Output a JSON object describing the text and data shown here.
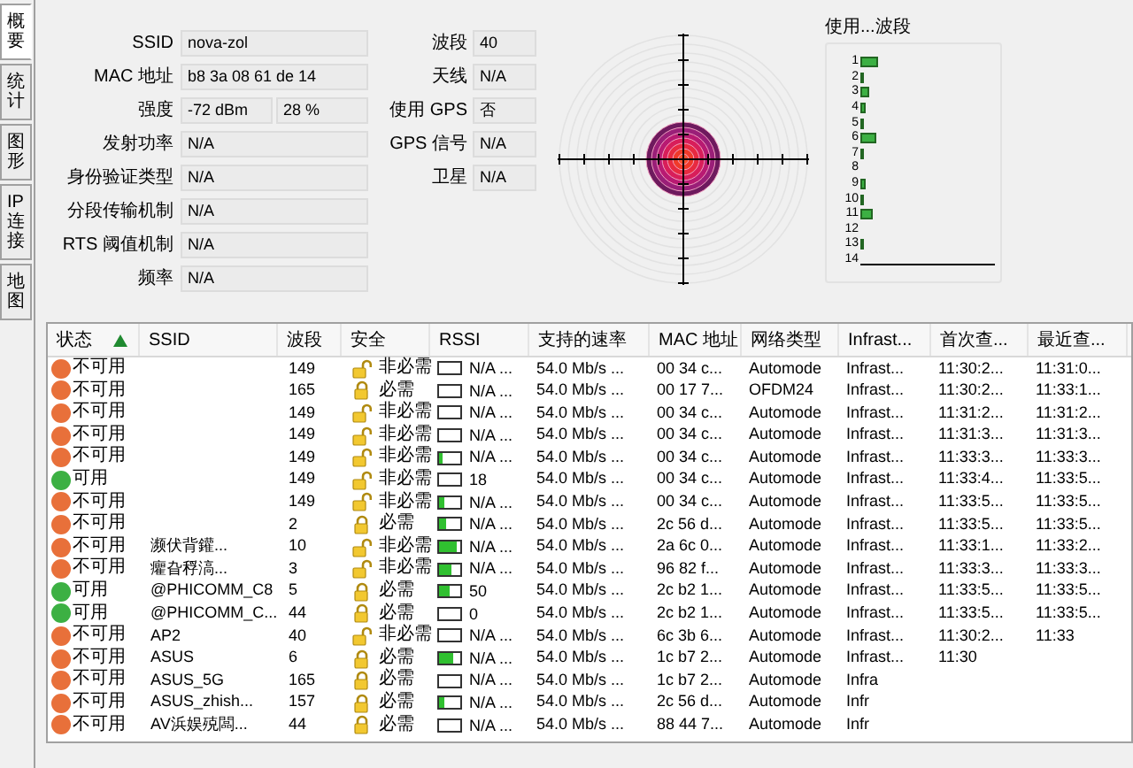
{
  "side_tabs": [
    {
      "label": "概要",
      "selected": true
    },
    {
      "label": "统计",
      "selected": false
    },
    {
      "label": "图形",
      "selected": false
    },
    {
      "label": "IP连接",
      "selected": false
    },
    {
      "label": "地图",
      "selected": false
    }
  ],
  "details": {
    "left": [
      {
        "label": "SSID",
        "value": "nova-zol"
      },
      {
        "label": "MAC 地址",
        "value": "b8 3a 08 61 de 14"
      },
      {
        "label": "强度",
        "value": "-72 dBm",
        "value_2": "28 %"
      },
      {
        "label": "发射功率",
        "value": "N/A"
      },
      {
        "label": "身份验证类型",
        "value": "N/A"
      },
      {
        "label": "分段传输机制",
        "value": "N/A"
      },
      {
        "label": "RTS 阈值机制",
        "value": "N/A"
      },
      {
        "label": "频率",
        "value": "N/A"
      }
    ],
    "right": [
      {
        "label": "波段",
        "value": "40"
      },
      {
        "label": "天线",
        "value": "N/A"
      },
      {
        "label": "使用 GPS",
        "value": "否"
      },
      {
        "label": "GPS 信号",
        "value": "N/A"
      },
      {
        "label": "卫星",
        "value": "N/A"
      }
    ]
  },
  "band_usage": {
    "title": "使用...波段",
    "channels": [
      "1",
      "2",
      "3",
      "4",
      "5",
      "6",
      "7",
      "8",
      "9",
      "10",
      "11",
      "12",
      "13",
      "14"
    ]
  },
  "table": {
    "columns": [
      {
        "label": "状态",
        "sorted": true
      },
      {
        "label": "SSID",
        "sorted": false
      },
      {
        "label": "波段",
        "sorted": false
      },
      {
        "label": "安全",
        "sorted": false
      },
      {
        "label": "RSSI",
        "sorted": false
      },
      {
        "label": "支持的速率",
        "sorted": false
      },
      {
        "label": "MAC 地址",
        "sorted": false
      },
      {
        "label": "网络类型",
        "sorted": false
      },
      {
        "label": "Infrast...",
        "sorted": false
      },
      {
        "label": "首次查...",
        "sorted": false
      },
      {
        "label": "最近查...",
        "sorted": false
      }
    ],
    "rows": [
      {
        "status": "不可用",
        "color": "#e8703a",
        "band": "149",
        "locked": false,
        "security": "非必需",
        "level": 0,
        "rssi": "N/A ...",
        "rate": "54.0 Mb/s ...",
        "mac": "00 34 c...",
        "net_type": "Automode",
        "infra": "Infrast...",
        "first_seen": "11:30:2...",
        "last_seen": "11:31:0..."
      },
      {
        "status": "不可用",
        "color": "#e8703a",
        "band": "165",
        "locked": true,
        "security": "必需",
        "level": 0,
        "rssi": "N/A ...",
        "rate": "54.0 Mb/s ...",
        "mac": "00 17 7...",
        "net_type": "OFDM24",
        "infra": "Infrast...",
        "first_seen": "11:30:2...",
        "last_seen": "11:33:1..."
      },
      {
        "status": "不可用",
        "color": "#e8703a",
        "band": "149",
        "locked": false,
        "security": "非必需",
        "level": 0,
        "rssi": "N/A ...",
        "rate": "54.0 Mb/s ...",
        "mac": "00 34 c...",
        "net_type": "Automode",
        "infra": "Infrast...",
        "first_seen": "11:31:2...",
        "last_seen": "11:31:2..."
      },
      {
        "status": "不可用",
        "color": "#e8703a",
        "band": "149",
        "locked": false,
        "security": "非必需",
        "level": 0,
        "rssi": "N/A ...",
        "rate": "54.0 Mb/s ...",
        "mac": "00 34 c...",
        "net_type": "Automode",
        "infra": "Infrast...",
        "first_seen": "11:31:3...",
        "last_seen": "11:31:3..."
      },
      {
        "status": "不可用",
        "color": "#e8703a",
        "band": "149",
        "locked": false,
        "security": "非必需",
        "level": 0.2,
        "rssi": "N/A ...",
        "rate": "54.0 Mb/s ...",
        "mac": "00 34 c...",
        "net_type": "Automode",
        "infra": "Infrast...",
        "first_seen": "11:33:3...",
        "last_seen": "11:33:3..."
      },
      {
        "status": "可用",
        "color": "#3cb043",
        "band": "149",
        "locked": false,
        "security": "非必需",
        "level": 0,
        "rssi": "18",
        "rate": "54.0 Mb/s ...",
        "mac": "00 34 c...",
        "net_type": "Automode",
        "infra": "Infrast...",
        "first_seen": "11:33:4...",
        "last_seen": "11:33:5..."
      },
      {
        "status": "不可用",
        "color": "#e8703a",
        "band": "149",
        "locked": false,
        "security": "非必需",
        "level": 0.25,
        "rssi": "N/A ...",
        "rate": "54.0 Mb/s ...",
        "mac": "00 34 c...",
        "net_type": "Automode",
        "infra": "Infrast...",
        "first_seen": "11:33:5...",
        "last_seen": "11:33:5..."
      },
      {
        "status": "不可用",
        "color": "#e8703a",
        "band": "2",
        "locked": true,
        "security": "必需",
        "level": 0.3,
        "rssi": "N/A ...",
        "rate": "54.0 Mb/s ...",
        "mac": "2c 56 d...",
        "net_type": "Automode",
        "infra": "Infrast...",
        "first_seen": "11:33:5...",
        "last_seen": "11:33:5..."
      },
      {
        "status": "不可用",
        "color": "#e8703a",
        "ssid": "濒伏背鑵...",
        "band": "10",
        "locked": false,
        "security": "非必需",
        "level": 0.8,
        "rssi": "N/A ...",
        "rate": "54.0 Mb/s ...",
        "mac": "2a 6c 0...",
        "net_type": "Automode",
        "infra": "Infrast...",
        "first_seen": "11:33:1...",
        "last_seen": "11:33:2..."
      },
      {
        "status": "不可用",
        "color": "#e8703a",
        "ssid": "癯旮稃滈...",
        "band": "3",
        "locked": false,
        "security": "非必需",
        "level": 0.6,
        "rssi": "N/A ...",
        "rate": "54.0 Mb/s ...",
        "mac": "96 82 f...",
        "net_type": "Automode",
        "infra": "Infrast...",
        "first_seen": "11:33:3...",
        "last_seen": "11:33:3..."
      },
      {
        "status": "可用",
        "color": "#3cb043",
        "ssid": "@PHICOMM_C8",
        "band": "5",
        "locked": true,
        "security": "必需",
        "level": 0.5,
        "rssi": "50",
        "rate": "54.0 Mb/s ...",
        "mac": "2c b2 1...",
        "net_type": "Automode",
        "infra": "Infrast...",
        "first_seen": "11:33:5...",
        "last_seen": "11:33:5..."
      },
      {
        "status": "可用",
        "color": "#3cb043",
        "ssid": "@PHICOMM_C...",
        "band": "44",
        "locked": true,
        "security": "必需",
        "level": 0,
        "rssi": "0",
        "rate": "54.0 Mb/s ...",
        "mac": "2c b2 1...",
        "net_type": "Automode",
        "infra": "Infrast...",
        "first_seen": "11:33:5...",
        "last_seen": "11:33:5..."
      },
      {
        "status": "不可用",
        "color": "#e8703a",
        "ssid": "AP2",
        "band": "40",
        "locked": false,
        "security": "非必需",
        "level": 0,
        "rssi": "N/A ...",
        "rate": "54.0 Mb/s ...",
        "mac": "6c 3b 6...",
        "net_type": "Automode",
        "infra": "Infrast...",
        "first_seen": "11:30:2...",
        "last_seen": "11:33"
      },
      {
        "status": "不可用",
        "color": "#e8703a",
        "ssid": "ASUS",
        "band": "6",
        "locked": true,
        "security": "必需",
        "level": 0.7,
        "rssi": "N/A ...",
        "rate": "54.0 Mb/s ...",
        "mac": "1c b7 2...",
        "net_type": "Automode",
        "infra": "Infrast...",
        "first_seen": "11:30"
      },
      {
        "status": "不可用",
        "color": "#e8703a",
        "ssid": "ASUS_5G",
        "band": "165",
        "locked": true,
        "security": "必需",
        "level": 0,
        "rssi": "N/A ...",
        "rate": "54.0 Mb/s ...",
        "mac": "1c b7 2...",
        "net_type": "Automode",
        "infra": "Infra"
      },
      {
        "status": "不可用",
        "color": "#e8703a",
        "ssid": "ASUS_zhish...",
        "band": "157",
        "locked": true,
        "security": "必需",
        "level": 0.25,
        "rssi": "N/A ...",
        "rate": "54.0 Mb/s ...",
        "mac": "2c 56 d...",
        "net_type": "Automode",
        "infra": "Infr"
      },
      {
        "status": "不可用",
        "color": "#e8703a",
        "ssid": "AV浜娱殑闆...",
        "band": "44",
        "locked": true,
        "security": "必需",
        "level": 0,
        "rssi": "N/A ...",
        "rate": "54.0 Mb/s ...",
        "mac": "88 44 7...",
        "net_type": "Automode",
        "infra": "Infr"
      }
    ]
  }
}
